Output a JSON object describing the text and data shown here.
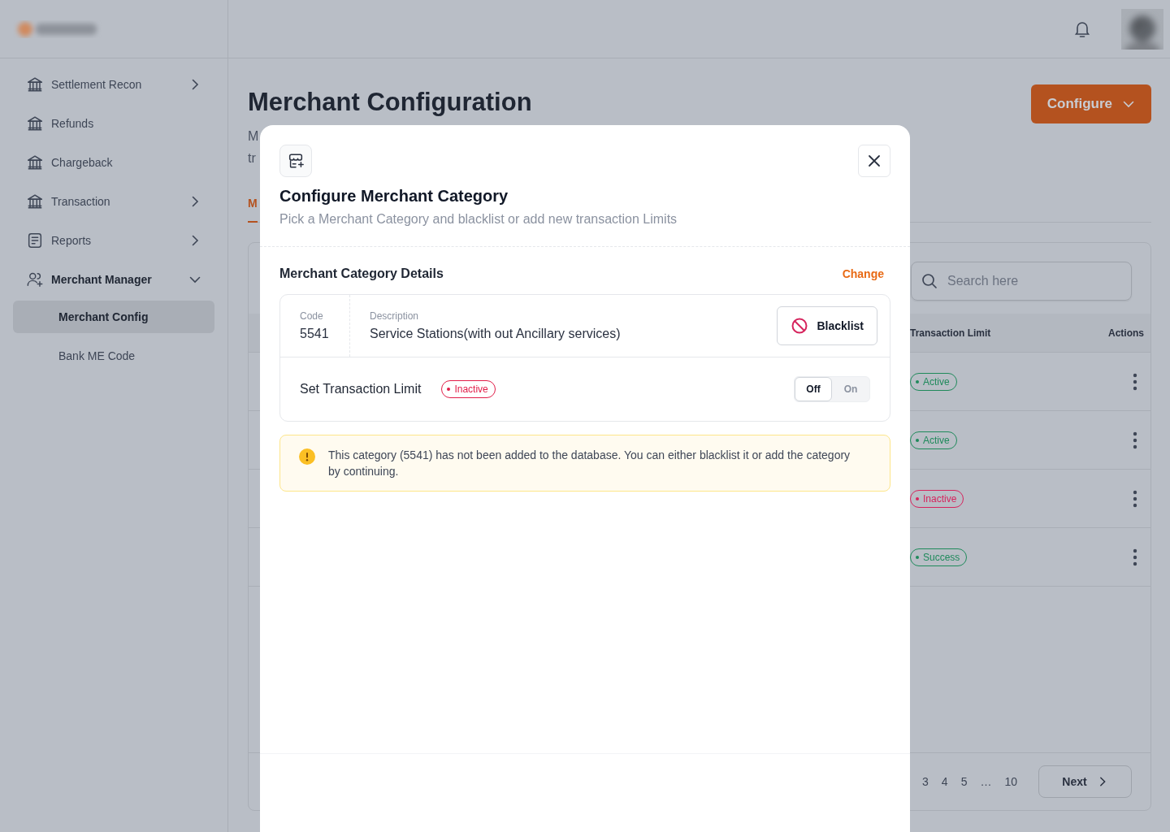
{
  "sidebar": {
    "items": [
      {
        "label": "Settlement Recon",
        "kind": "bank",
        "expanded": false
      },
      {
        "label": "Refunds",
        "kind": "bank"
      },
      {
        "label": "Chargeback",
        "kind": "bank"
      },
      {
        "label": "Transaction",
        "kind": "bank",
        "expanded": false
      },
      {
        "label": "Reports",
        "kind": "document",
        "expanded": false
      },
      {
        "label": "Merchant Manager",
        "kind": "users",
        "expanded": true,
        "children": [
          {
            "label": "Merchant Config",
            "selected": true
          },
          {
            "label": "Bank ME Code",
            "selected": false
          }
        ]
      }
    ]
  },
  "page": {
    "title": "Merchant Configuration",
    "subtitle_visible": [
      "M",
      "tr"
    ],
    "configure_button": "Configure",
    "tabs": [
      {
        "label": "M",
        "selected": true
      }
    ],
    "search": {
      "placeholder": "Search here"
    },
    "table": {
      "columns": [
        "Transaction Limit",
        "Actions"
      ],
      "rows": [
        {
          "status": "Active",
          "color": "#1f8a5b"
        },
        {
          "status": "Active",
          "color": "#1f8a5b"
        },
        {
          "status": "Inactive",
          "color": "#d6245d"
        },
        {
          "status": "Success",
          "color": "#1f8a5b"
        }
      ]
    },
    "pagination": {
      "pages": [
        "3",
        "4",
        "5",
        "…",
        "10"
      ],
      "next": "Next"
    }
  },
  "modal": {
    "title": "Configure Merchant Category",
    "subtitle": "Pick a Merchant Category and blacklist or add new transaction Limits",
    "section_title": "Merchant Category Details",
    "change_link": "Change",
    "code_label": "Code",
    "code": "5541",
    "description_label": "Description",
    "description": "Service Stations(with out Ancillary services)",
    "blacklist_button": "Blacklist",
    "limit_label": "Set Transaction Limit",
    "limit_status": {
      "label": "Inactive",
      "color": "#e11d48"
    },
    "toggle": [
      {
        "label": "Off",
        "selected": true
      },
      {
        "label": "On",
        "selected": false
      }
    ],
    "alert": "This category (5541) has not been added to the database. You can either blacklist it or add the category by continuing."
  }
}
